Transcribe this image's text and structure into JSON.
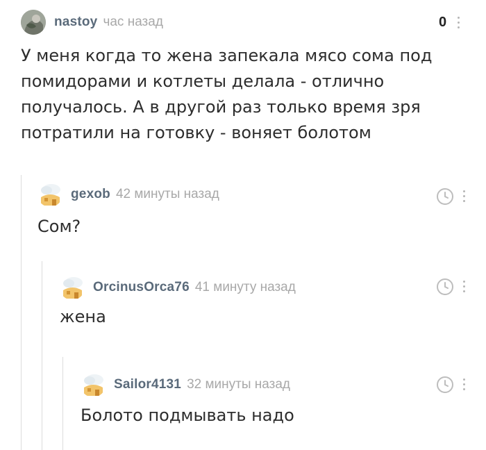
{
  "comments": [
    {
      "username": "nastoy",
      "time": "час назад",
      "rating": "0",
      "text": "У меня когда то жена запекала мясо сома под помидорами и котлеты делала - отлично получалось. А в другой раз только время зря потратили на готовку - воняет болотом",
      "avatar": "photo-avatar"
    },
    {
      "username": "gexob",
      "time": "42 минуты назад",
      "text": "Сом?",
      "avatar": "default-avatar"
    },
    {
      "username": "OrcinusOrca76",
      "time": "41 минуту назад",
      "text": "жена",
      "avatar": "default-avatar"
    },
    {
      "username": "Sailor4131",
      "time": "32 минуты назад",
      "text": "Болото подмывать надо",
      "avatar": "default-avatar"
    }
  ],
  "icons": {
    "more": "more-dots-icon",
    "clock": "clock-icon"
  },
  "colors": {
    "username": "#5a6a7a",
    "timestamp": "#a8a8a8",
    "thread_line": "#dcdcdc",
    "avatar_default": "#f2c46a"
  }
}
